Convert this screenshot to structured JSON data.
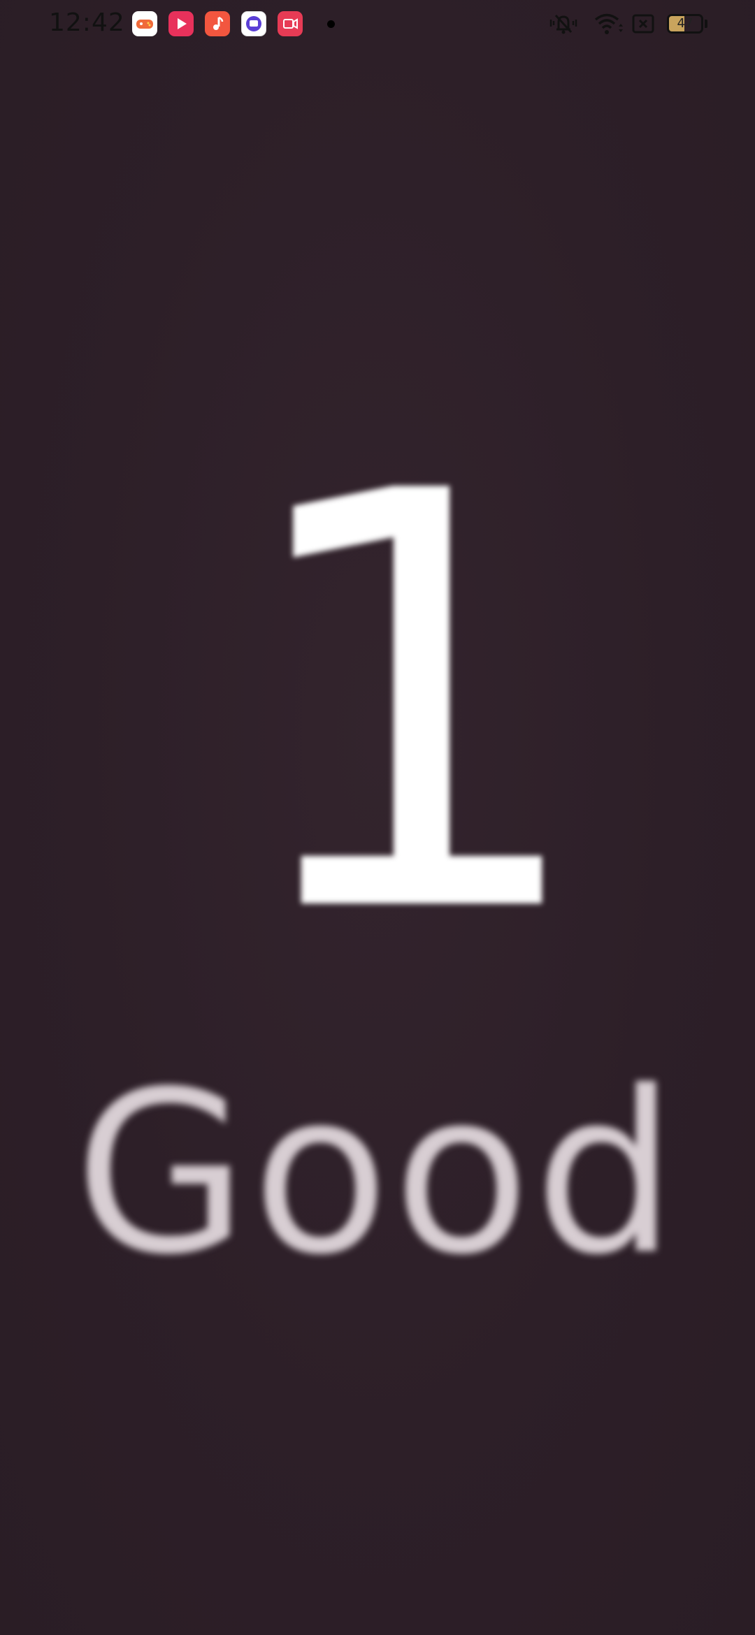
{
  "status_bar": {
    "time": "12:42",
    "notification_icons": [
      "game-center-icon",
      "video-player-icon",
      "music-icon",
      "chat-icon",
      "screen-recorder-icon"
    ],
    "system_icons": [
      "silent-mode-icon",
      "wifi-icon",
      "sim-off-icon"
    ],
    "battery_level": "47",
    "battery_fraction": 0.47,
    "battery_color": "#c9a45d"
  },
  "main": {
    "count": "1",
    "rating": "Good"
  },
  "colors": {
    "background": "#2d1f28",
    "count_text": "#ffffff",
    "rating_text": "#d8ced3"
  }
}
